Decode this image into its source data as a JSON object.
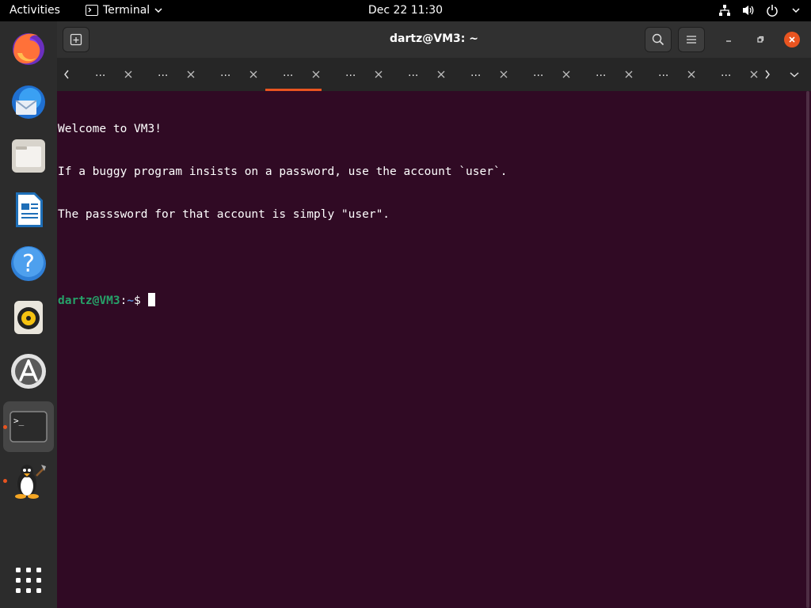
{
  "topbar": {
    "activities": "Activities",
    "app_name": "Terminal",
    "clock": "Dec 22  11:30"
  },
  "dock": {
    "items": [
      {
        "name": "Firefox"
      },
      {
        "name": "Thunderbird"
      },
      {
        "name": "Files"
      },
      {
        "name": "LibreOffice Writer"
      },
      {
        "name": "Help"
      },
      {
        "name": "Rhythmbox"
      },
      {
        "name": "Ubuntu Software"
      },
      {
        "name": "Terminal"
      },
      {
        "name": "Tux"
      },
      {
        "name": "Show Applications"
      }
    ]
  },
  "window": {
    "title": "dartz@VM3: ~"
  },
  "tabs": [
    {
      "label": "..."
    },
    {
      "label": "..."
    },
    {
      "label": "..."
    },
    {
      "label": "..."
    },
    {
      "label": "..."
    },
    {
      "label": "..."
    },
    {
      "label": "..."
    },
    {
      "label": "..."
    },
    {
      "label": "..."
    },
    {
      "label": "..."
    },
    {
      "label": "..."
    }
  ],
  "terminal": {
    "lines": [
      "Welcome to VM3!",
      "If a buggy program insists on a password, use the account `user`.",
      "The passsword for that account is simply \"user\"."
    ],
    "prompt_user": "dartz@VM3",
    "prompt_sep": ":",
    "prompt_path": "~",
    "prompt_symbol": "$ "
  },
  "colors": {
    "terminal_bg": "#300a24",
    "accent": "#e95420",
    "prompt_user": "#26a269",
    "prompt_path": "#5a8fd8"
  }
}
